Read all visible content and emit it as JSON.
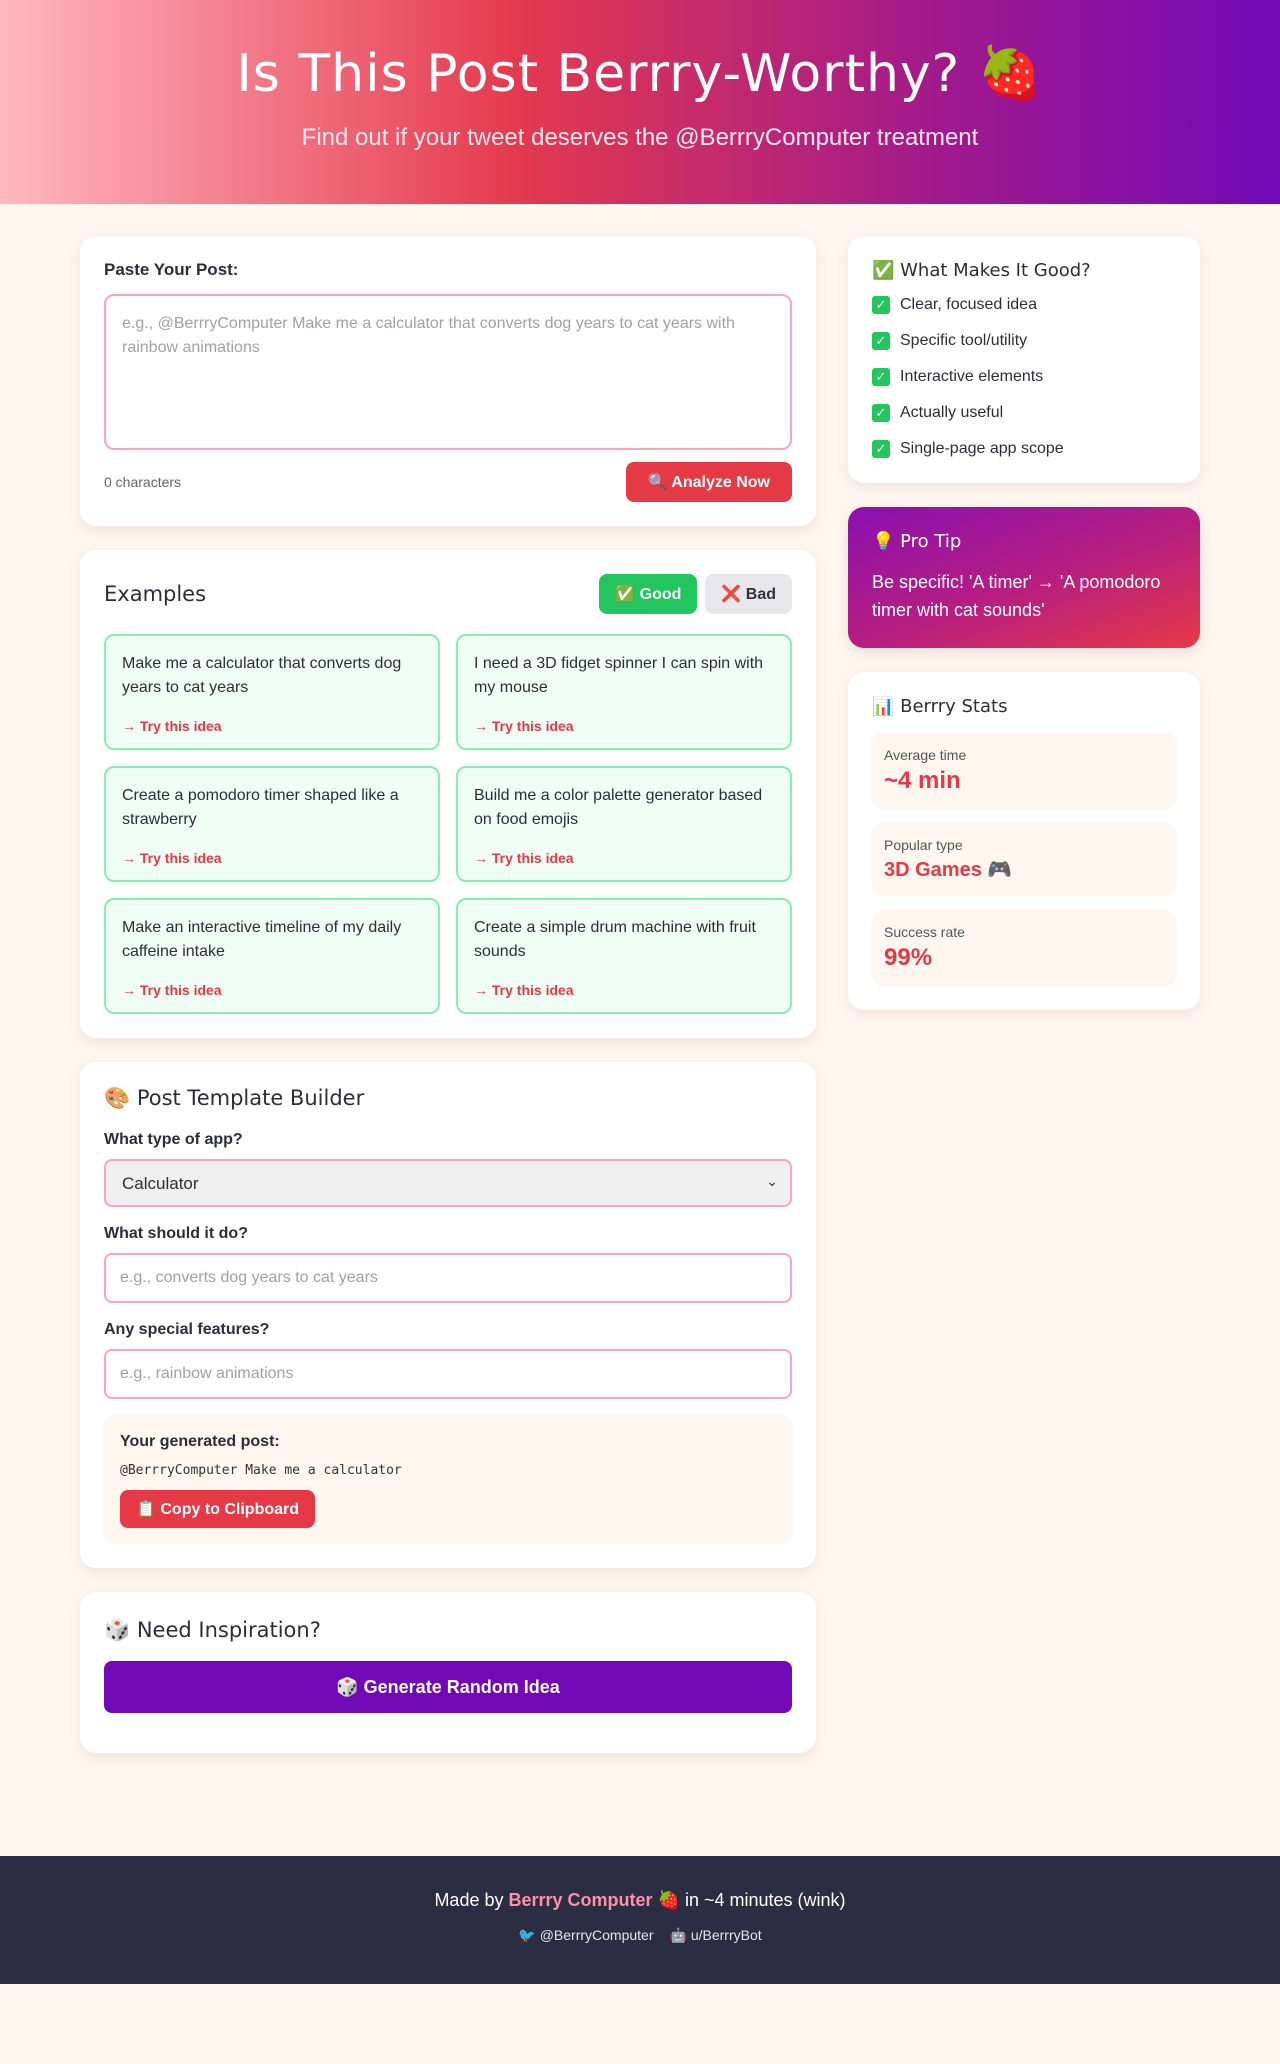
{
  "header": {
    "title": "Is This Post Berrry-Worthy? 🍓",
    "subtitle": "Find out if your tweet deserves the @BerrryComputer treatment"
  },
  "paste": {
    "label": "Paste Your Post:",
    "placeholder": "e.g., @BerrryComputer Make me a calculator that converts dog years to cat years with rainbow animations",
    "char_count": "0 characters",
    "analyze_label": "🔍 Analyze Now"
  },
  "examples": {
    "title": "Examples",
    "good_label": "✅ Good",
    "bad_label": "❌ Bad",
    "items": [
      {
        "text": "Make me a calculator that converts dog years to cat years",
        "link": "→ Try this idea"
      },
      {
        "text": "I need a 3D fidget spinner I can spin with my mouse",
        "link": "→ Try this idea"
      },
      {
        "text": "Create a pomodoro timer shaped like a strawberry",
        "link": "→ Try this idea"
      },
      {
        "text": "Build me a color palette generator based on food emojis",
        "link": "→ Try this idea"
      },
      {
        "text": "Make an interactive timeline of my daily caffeine intake",
        "link": "→ Try this idea"
      },
      {
        "text": "Create a simple drum machine with fruit sounds",
        "link": "→ Try this idea"
      }
    ]
  },
  "builder": {
    "title": "🎨 Post Template Builder",
    "type_label": "What type of app?",
    "type_selected": "Calculator",
    "do_label": "What should it do?",
    "do_placeholder": "e.g., converts dog years to cat years",
    "features_label": "Any special features?",
    "features_placeholder": "e.g., rainbow animations",
    "generated_title": "Your generated post:",
    "generated_text": "@BerrryComputer Make me a calculator",
    "copy_label": "📋 Copy to Clipboard"
  },
  "inspiration": {
    "title": "🎲 Need Inspiration?",
    "button_label": "🎲 Generate Random Idea"
  },
  "good_list": {
    "title": "✅ What Makes It Good?",
    "items": [
      "Clear, focused idea",
      "Specific tool/utility",
      "Interactive elements",
      "Actually useful",
      "Single-page app scope"
    ]
  },
  "pro_tip": {
    "title": "💡 Pro Tip",
    "text": "Be specific! 'A timer' → 'A pomodoro timer with cat sounds'"
  },
  "stats": {
    "title": "📊 Berrry Stats",
    "items": [
      {
        "label": "Average time",
        "value": "~4 min"
      },
      {
        "label": "Popular type",
        "value": "3D Games 🎮"
      },
      {
        "label": "Success rate",
        "value": "99%"
      }
    ]
  },
  "footer": {
    "made_by_prefix": "Made by",
    "brand": "Berrry Computer",
    "made_by_suffix": "🍓 in ~4 minutes (wink)",
    "link_twitter": "🐦 @BerrryComputer",
    "link_reddit": "🤖 u/BerrryBot"
  },
  "colors": {
    "accent": "#e63946",
    "purple": "#7209b7",
    "good_green": "#22c55e",
    "background": "#fff6ef",
    "footer_bg": "#2b2d42"
  }
}
